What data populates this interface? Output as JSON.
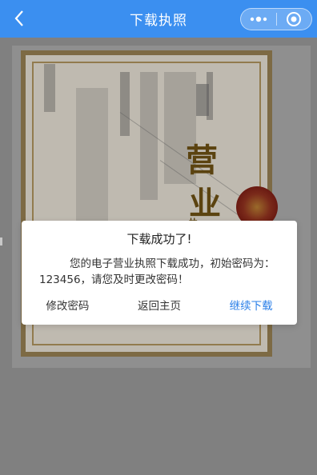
{
  "navbar": {
    "title": "下载执照",
    "back_icon": "chevron-left-icon",
    "more_icon": "more-dots-icon",
    "close_icon": "target-close-icon"
  },
  "license": {
    "heading_chars": [
      "营",
      "业",
      "执"
    ],
    "colors": {
      "frame": "#7d6a44",
      "paper": "#bfbab0",
      "seal": "#7a2a1a"
    }
  },
  "dialog": {
    "title": "下载成功了!",
    "message": "您的电子营业执照下载成功，初始密码为：123456，请您及时更改密码！",
    "buttons": {
      "change_password": "修改密码",
      "back_home": "返回主页",
      "continue_download": "继续下载"
    },
    "accent_color": "#2a7fe8"
  },
  "colors": {
    "nav": "#3b8ff0",
    "mask": "#808080"
  }
}
